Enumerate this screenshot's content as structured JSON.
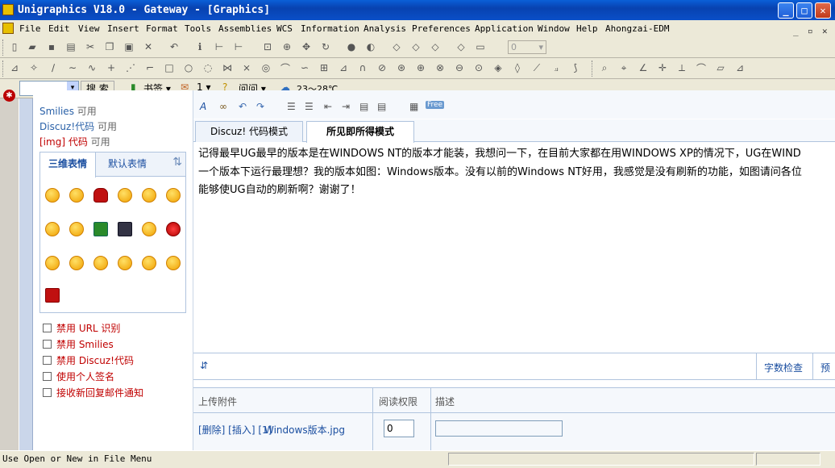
{
  "window": {
    "title": "Unigraphics V18.0 - Gateway - [Graphics]"
  },
  "menu": [
    "File",
    "Edit",
    "View",
    "Insert",
    "Format",
    "Tools",
    "Assemblies",
    "WCS",
    "Information",
    "Analysis",
    "Preferences",
    "Application",
    "Window",
    "Help",
    "Ahongzai-EDM"
  ],
  "toolbar": {
    "layer_value": "0"
  },
  "browserbar": {
    "search_label": "搜 索",
    "bookmark_label": "书签",
    "page_count": "1",
    "help_label": "问问",
    "weather_text": "23～28℃"
  },
  "left_panel": {
    "lines": [
      {
        "label": "Smilies",
        "suffix": "可用"
      },
      {
        "label": "Discuz!代码",
        "suffix": "可用"
      },
      {
        "label": "[img] 代码",
        "suffix": "可用"
      }
    ],
    "tabs": [
      "三维表情",
      "默认表情"
    ],
    "checkboxes": [
      "禁用  URL 识别",
      "禁用  Smilies",
      "禁用  Discuz!代码",
      "使用个人签名",
      "接收新回复邮件通知"
    ]
  },
  "editor": {
    "mode_tabs": [
      "Discuz! 代码模式",
      "所见即所得模式"
    ],
    "content_lines": [
      "记得最早UG最早的版本是在WINDOWS NT的版本才能装，我想问一下，在目前大家都在用WINDOWS XP的情况下，UG在WIND",
      "一个版本下运行最理想？我的版本如图：Windows版本。没有以前的Windows NT好用，我感觉是没有刷新的功能，如图请问各位",
      "能够使UG自动的刷新啊？谢谢了！"
    ],
    "footer": {
      "spellcheck": "字数检查",
      "preview": "预"
    }
  },
  "attachments": {
    "headers": [
      "上传附件",
      "阅读权限",
      "描述"
    ],
    "row": {
      "actions": "[删除] [插入] [1]",
      "filename": "Windows版本.jpg",
      "permission": "0",
      "description": ""
    }
  },
  "status": {
    "text": "Use Open or New in File Menu"
  }
}
